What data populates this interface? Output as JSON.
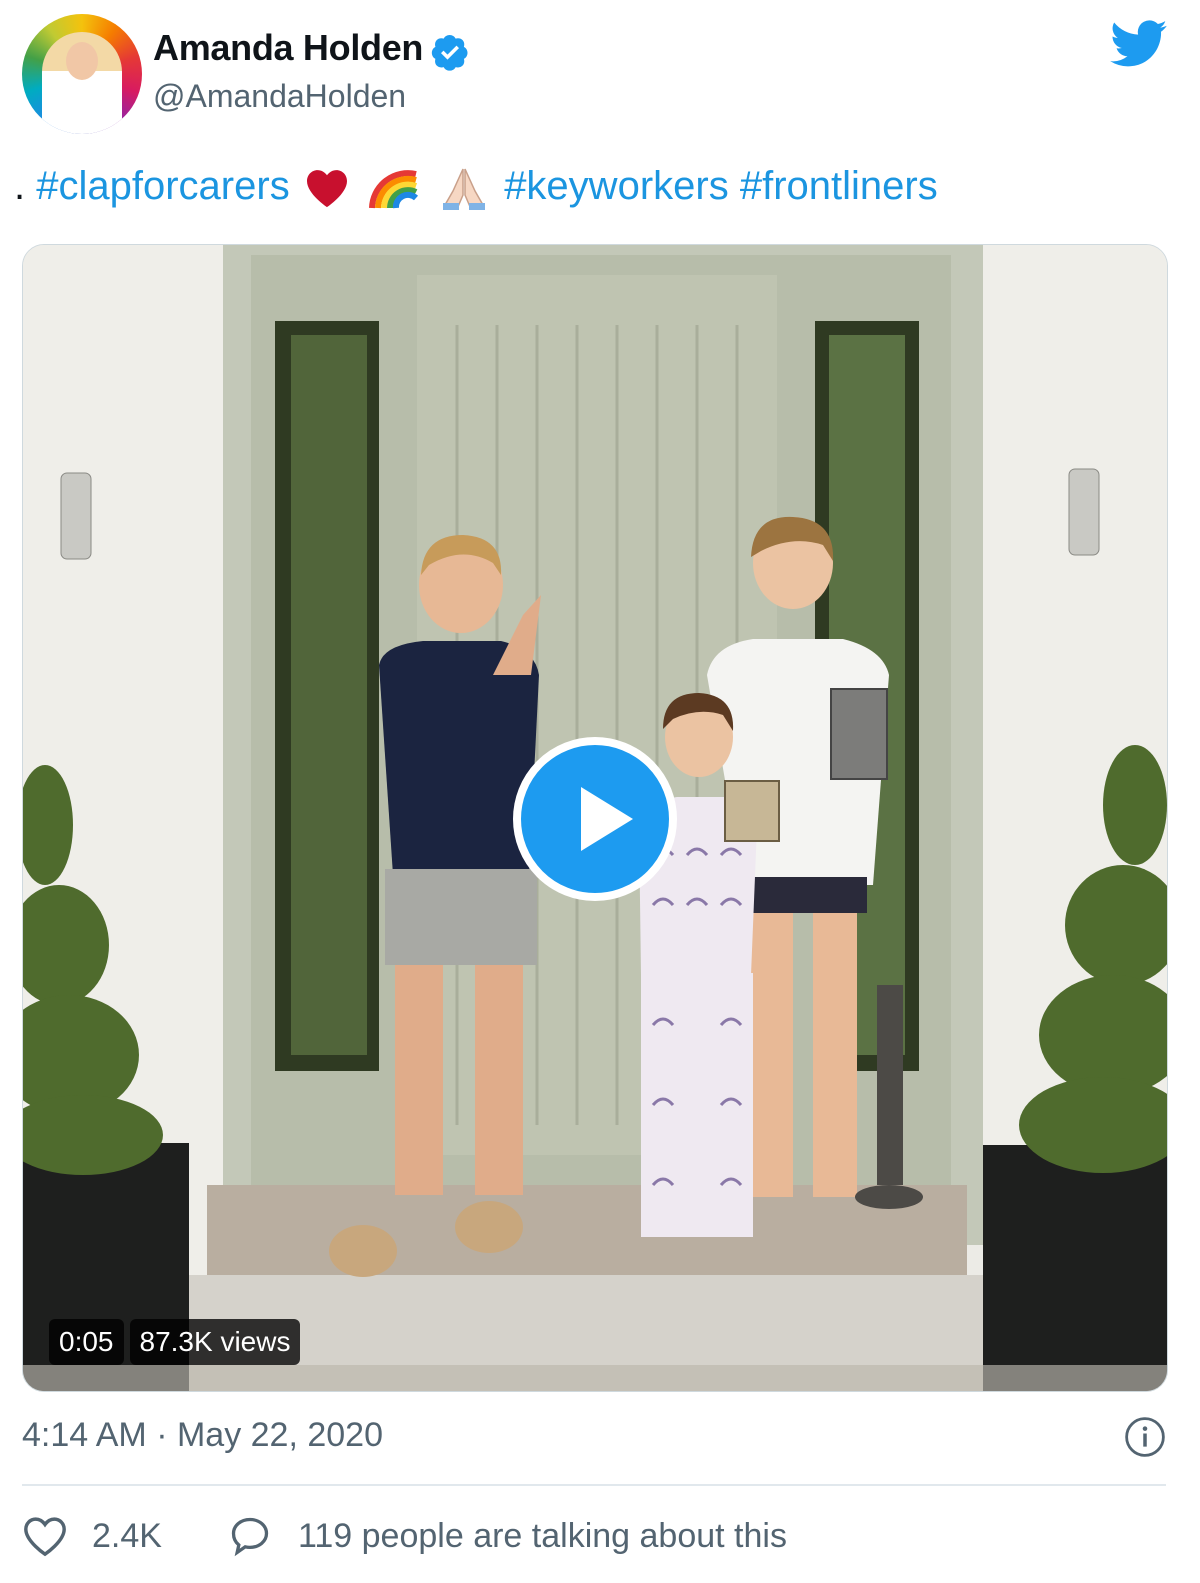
{
  "author": {
    "display_name": "Amanda Holden",
    "handle": "@AmandaHolden",
    "verified": true
  },
  "tweet": {
    "lead": ".",
    "hashtag1": "#clapforcarers",
    "emojis": [
      "heart-emoji",
      "rainbow-emoji",
      "folded-hands-emoji"
    ],
    "hashtag2": "#keyworkers",
    "hashtag3": "#frontliners"
  },
  "media": {
    "type": "video",
    "duration": "0:05",
    "views": "87.3K views"
  },
  "meta": {
    "timestamp": "4:14 AM · May 22, 2020"
  },
  "actions": {
    "likes": "2.4K",
    "talking": "119 people are talking about this"
  },
  "icons": {
    "brand": "twitter-bird-icon",
    "verified": "verified-badge-icon",
    "info": "info-icon",
    "like": "heart-outline-icon",
    "reply": "speech-bubble-icon"
  },
  "colors": {
    "accent": "#1d9bf0",
    "text": "#0f1419",
    "muted": "#536471"
  }
}
